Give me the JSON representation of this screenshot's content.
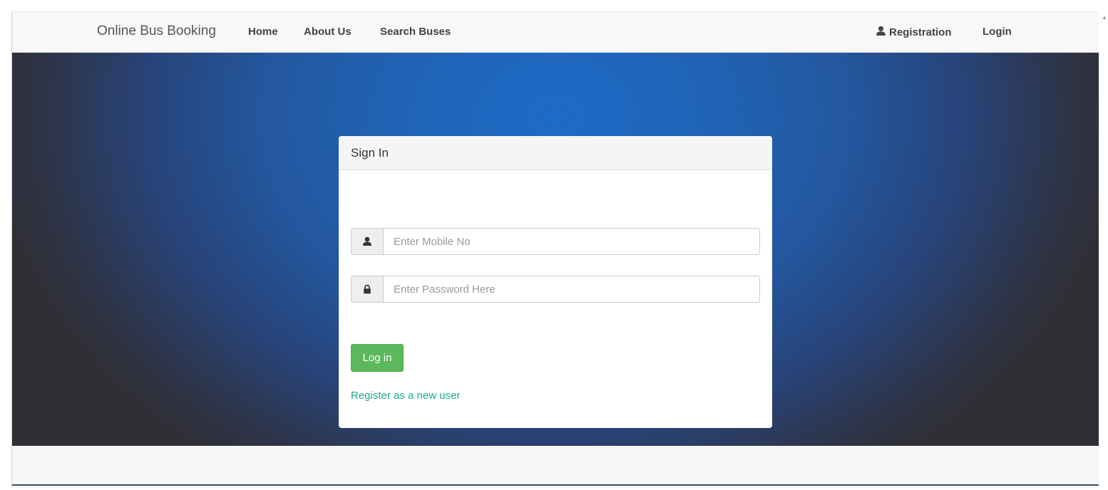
{
  "navbar": {
    "brand": "Online Bus Booking",
    "links": [
      "Home",
      "About Us",
      "Search Buses"
    ],
    "right_links": {
      "registration": "Registration",
      "login": "Login"
    }
  },
  "signin": {
    "title": "Sign In",
    "mobile": {
      "placeholder": "Enter Mobile No",
      "icon": "user-icon"
    },
    "password": {
      "placeholder": "Enter Password Here",
      "icon": "lock-icon"
    },
    "login_button": "Log in",
    "register_link": "Register as a new user"
  },
  "colors": {
    "accent_green": "#5cb85c",
    "link_teal": "#1aab8a",
    "hero_center": "#1d6bc8",
    "hero_edge": "#2f2f36"
  }
}
